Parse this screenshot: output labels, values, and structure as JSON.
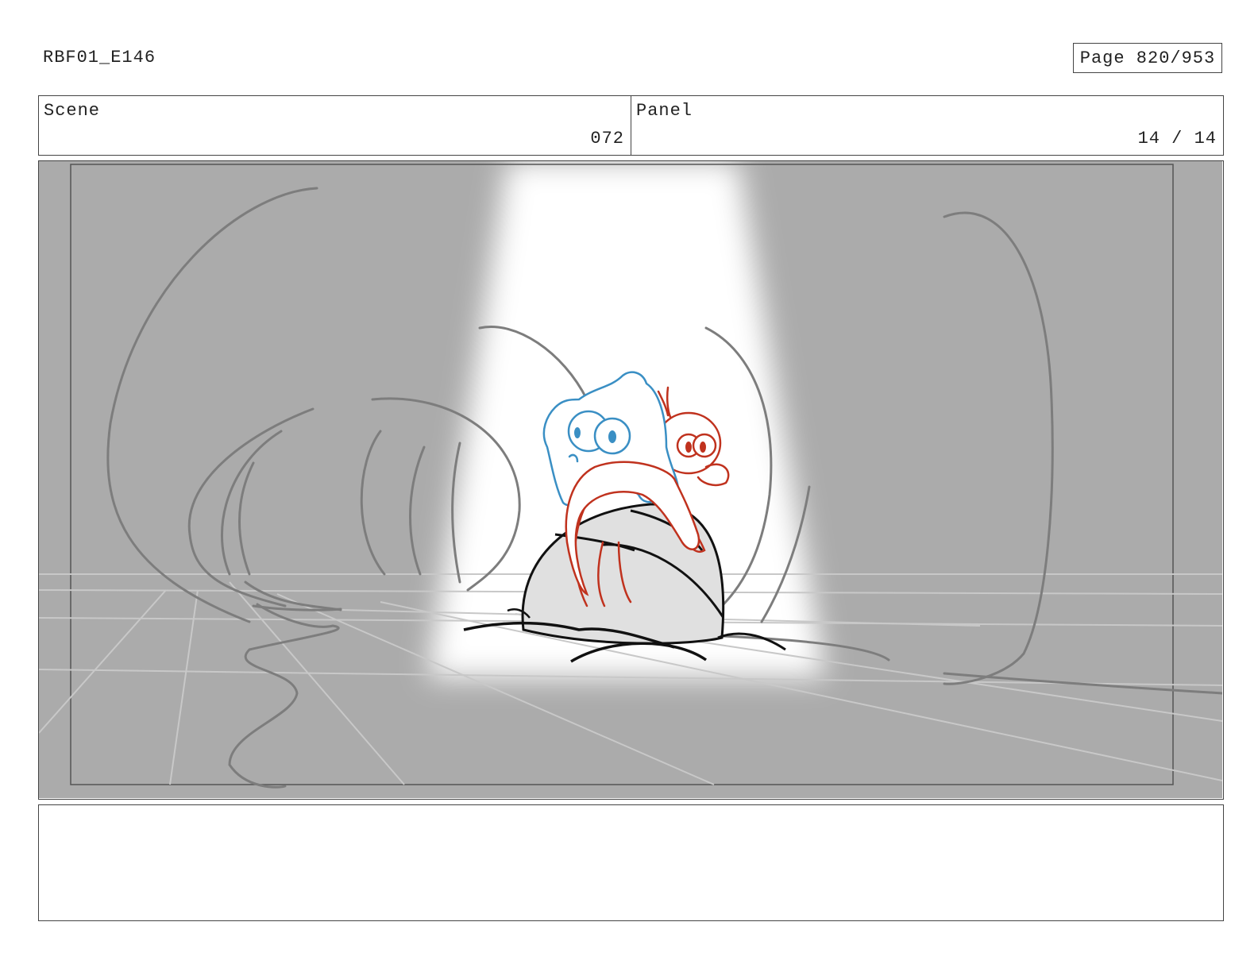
{
  "header": {
    "doc_id": "RBF01_E146",
    "page_label": "Page 820/953"
  },
  "scene": {
    "label": "Scene",
    "value": "072"
  },
  "panel": {
    "label": "Panel",
    "value": "14 / 14"
  },
  "artwork": {
    "subject": "storyboard-sketch",
    "colors": {
      "background": "#ababab",
      "spotlight": "#ffffff",
      "rock": "#e0e0e0",
      "blue_character": "#3a8fc4",
      "red_character": "#c0321e",
      "ink": "#111111"
    }
  },
  "notes": {
    "text": ""
  }
}
